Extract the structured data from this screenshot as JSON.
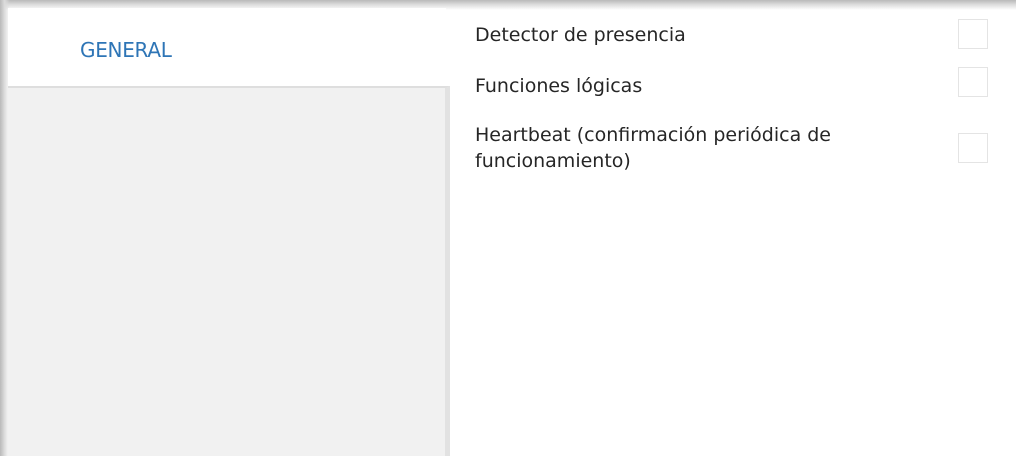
{
  "sidebar": {
    "tab_general": "GENERAL"
  },
  "params": [
    {
      "label": "Detector de presencia",
      "checked": false
    },
    {
      "label": "Funciones lógicas",
      "checked": false
    },
    {
      "label": "Heartbeat (confirmación periódica de funcionamiento)",
      "checked": false
    }
  ],
  "colors": {
    "accent": "#2e75b6",
    "text": "#262626",
    "panel": "#f1f1f1"
  }
}
